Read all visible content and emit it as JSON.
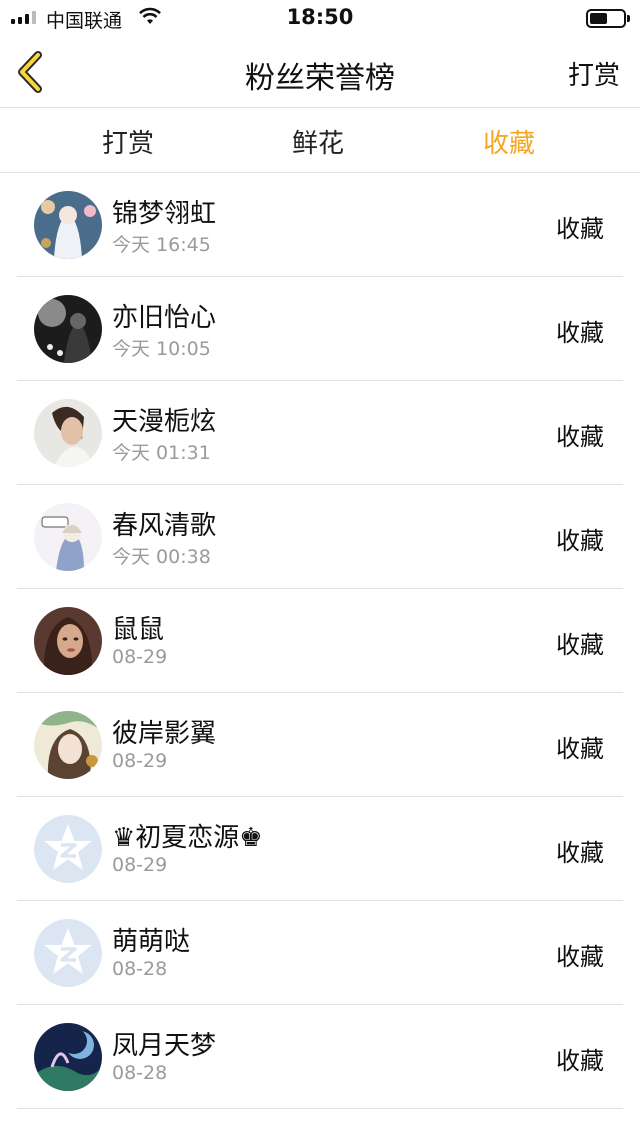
{
  "status_bar": {
    "carrier": "中国联通",
    "time": "18:50",
    "icons": [
      "signal-icon",
      "wifi-icon",
      "battery-icon"
    ]
  },
  "nav": {
    "back_icon": "chevron-left-icon",
    "title": "粉丝荣誉榜",
    "action": "打赏"
  },
  "tabs": [
    {
      "label": "打赏",
      "active": false
    },
    {
      "label": "鲜花",
      "active": false
    },
    {
      "label": "收藏",
      "active": true
    }
  ],
  "list": {
    "items": [
      {
        "name": "锦梦翎虹",
        "time": "今天 16:45",
        "action": "收藏",
        "avatar": "photo-avatar"
      },
      {
        "name": "亦旧怡心",
        "time": "今天 10:05",
        "action": "收藏",
        "avatar": "photo-avatar"
      },
      {
        "name": "天漫栀炫",
        "time": "今天 01:31",
        "action": "收藏",
        "avatar": "photo-avatar"
      },
      {
        "name": "春风清歌",
        "time": "今天 00:38",
        "action": "收藏",
        "avatar": "photo-avatar"
      },
      {
        "name": "鼠鼠",
        "time": "08-29",
        "action": "收藏",
        "avatar": "photo-avatar"
      },
      {
        "name": "彼岸影翼",
        "time": "08-29",
        "action": "收藏",
        "avatar": "photo-avatar"
      },
      {
        "name": "♛初夏恋源♚",
        "time": "08-29",
        "action": "收藏",
        "avatar": "default-avatar-icon"
      },
      {
        "name": "萌萌哒",
        "time": "08-28",
        "action": "收藏",
        "avatar": "default-avatar-icon"
      },
      {
        "name": "凤月天梦",
        "time": "08-28",
        "action": "收藏",
        "avatar": "photo-avatar"
      }
    ]
  },
  "colors": {
    "accent": "#f5a623",
    "muted_text": "#9b9b9b",
    "divider": "#e3e3e3",
    "default_avatar_bg": "#dbe6f2"
  }
}
